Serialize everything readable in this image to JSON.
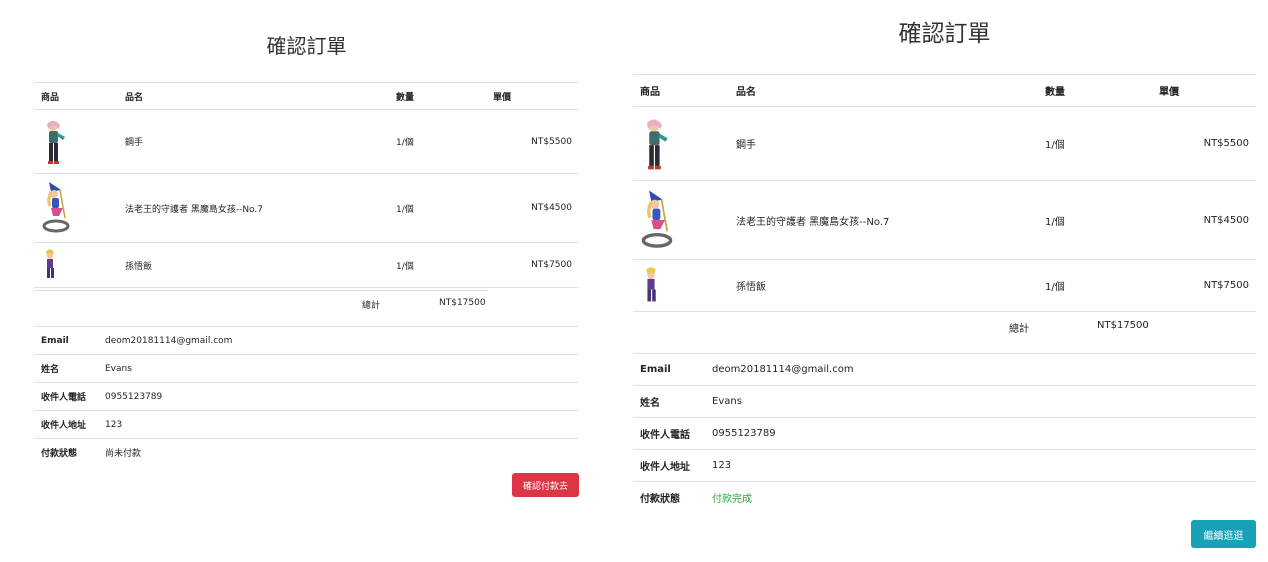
{
  "left": {
    "title": "確認訂單",
    "columns": [
      "商品",
      "品名",
      "數量",
      "單價"
    ],
    "items": [
      {
        "name": "鋼手",
        "qty": "1/個",
        "price": "NT$5500"
      },
      {
        "name": "法老王的守護者 黑魔島女孩--No.7",
        "qty": "1/個",
        "price": "NT$4500"
      },
      {
        "name": "孫悟飯",
        "qty": "1/個",
        "price": "NT$7500"
      }
    ],
    "total_label": "總計",
    "total_value": "NT$17500",
    "info": [
      {
        "label": "Email",
        "value": "deom20181114@gmail.com"
      },
      {
        "label": "姓名",
        "value": "Evans"
      },
      {
        "label": "收件人電話",
        "value": "0955123789"
      },
      {
        "label": "收件人地址",
        "value": "123"
      },
      {
        "label": "付款狀態",
        "value": "尚未付款"
      }
    ],
    "button_label": "確認付款去",
    "button_color": "#dc3545"
  },
  "right": {
    "title": "確認訂單",
    "columns": [
      "商品",
      "品名",
      "數量",
      "單價"
    ],
    "items": [
      {
        "name": "鋼手",
        "qty": "1/個",
        "price": "NT$5500"
      },
      {
        "name": "法老王的守護者 黑魔島女孩--No.7",
        "qty": "1/個",
        "price": "NT$4500"
      },
      {
        "name": "孫悟飯",
        "qty": "1/個",
        "price": "NT$7500"
      }
    ],
    "total_label": "總計",
    "total_value": "NT$17500",
    "info": [
      {
        "label": "Email",
        "value": "deom20181114@gmail.com"
      },
      {
        "label": "姓名",
        "value": "Evans"
      },
      {
        "label": "收件人電話",
        "value": "0955123789"
      },
      {
        "label": "收件人地址",
        "value": "123"
      },
      {
        "label": "付款狀態",
        "value": "付款完成"
      }
    ],
    "status_color": "#28a745",
    "button_label": "繼續逛逛",
    "button_color": "#17a2b8"
  }
}
